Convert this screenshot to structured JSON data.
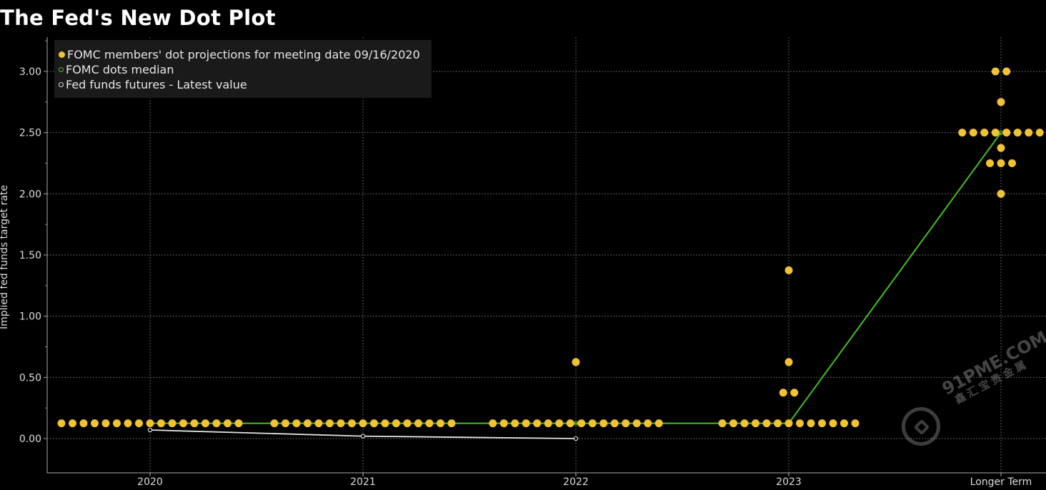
{
  "title": "The Fed's New Dot Plot",
  "watermark": {
    "line1": "91PME.COM",
    "line2": "鑫汇宝贵金属"
  },
  "colors": {
    "dots": "#f1c232",
    "median": "#44c026",
    "futures": "#e0e0e0",
    "grid": "#5a5a5a",
    "legend_bg": "#1a1a1a"
  },
  "chart_data": {
    "type": "scatter",
    "title": "The Fed's New Dot Plot",
    "ylabel": "Implied fed funds target rate",
    "xlabel": "",
    "ylim": [
      -0.28,
      3.28
    ],
    "yticks": [
      0.0,
      0.5,
      1.0,
      1.5,
      2.0,
      2.5,
      3.0
    ],
    "ytick_labels": [
      "0.00",
      "0.50",
      "1.00",
      "1.50",
      "2.00",
      "2.50",
      "3.00"
    ],
    "categories": [
      "2020",
      "2021",
      "2022",
      "2023",
      "Longer Term"
    ],
    "grid": true,
    "legend_position": "top-left",
    "legend": [
      "FOMC members' dot projections for meeting date 09/16/2020",
      "FOMC dots median",
      "Fed funds futures - Latest value"
    ],
    "series": [
      {
        "name": "FOMC members' dot projections for meeting date 09/16/2020",
        "marker": "dot",
        "points_per_category": [
          {
            "category": "2020",
            "values": [
              {
                "rate": 0.125,
                "count": 17
              }
            ]
          },
          {
            "category": "2021",
            "values": [
              {
                "rate": 0.125,
                "count": 17
              }
            ]
          },
          {
            "category": "2022",
            "values": [
              {
                "rate": 0.125,
                "count": 16
              },
              {
                "rate": 0.625,
                "count": 1
              }
            ]
          },
          {
            "category": "2023",
            "values": [
              {
                "rate": 0.125,
                "count": 13
              },
              {
                "rate": 0.375,
                "count": 2
              },
              {
                "rate": 0.625,
                "count": 1
              },
              {
                "rate": 1.375,
                "count": 1
              }
            ]
          },
          {
            "category": "Longer Term",
            "values": [
              {
                "rate": 2.0,
                "count": 1
              },
              {
                "rate": 2.25,
                "count": 3
              },
              {
                "rate": 2.375,
                "count": 1
              },
              {
                "rate": 2.5,
                "count": 8
              },
              {
                "rate": 2.75,
                "count": 1
              },
              {
                "rate": 3.0,
                "count": 2
              }
            ]
          }
        ]
      },
      {
        "name": "FOMC dots median",
        "marker": "line",
        "x": [
          "2020",
          "2021",
          "2022",
          "2023",
          "Longer Term"
        ],
        "values": [
          0.125,
          0.125,
          0.125,
          0.125,
          2.5
        ]
      },
      {
        "name": "Fed funds futures - Latest value",
        "marker": "line-with-dots",
        "x": [
          "2020",
          "2021",
          "2022"
        ],
        "values": [
          0.07,
          0.02,
          0.0
        ]
      }
    ]
  }
}
